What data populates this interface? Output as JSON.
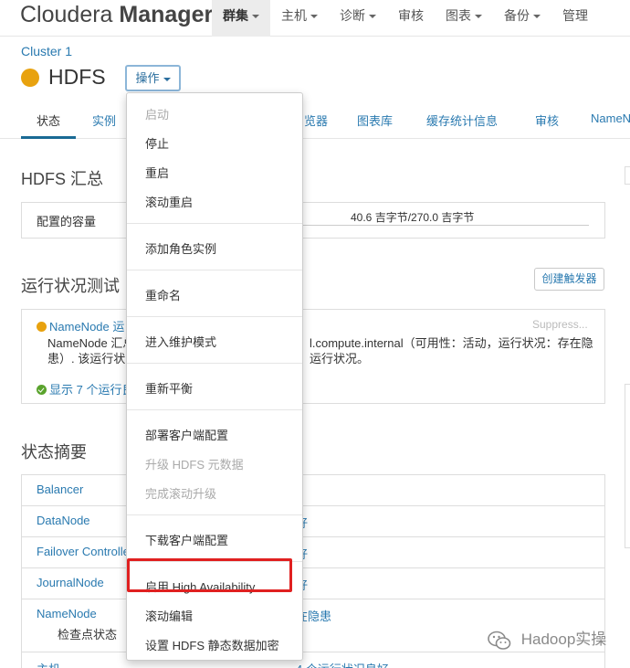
{
  "brand": {
    "name_thin": "Cloudera",
    "name_bold": "Manager"
  },
  "nav": {
    "items": [
      {
        "label": "群集",
        "active": true,
        "dropdown": true
      },
      {
        "label": "主机",
        "active": false,
        "dropdown": true
      },
      {
        "label": "诊断",
        "active": false,
        "dropdown": true
      },
      {
        "label": "审核",
        "active": false,
        "dropdown": false
      },
      {
        "label": "图表",
        "active": false,
        "dropdown": true
      },
      {
        "label": "备份",
        "active": false,
        "dropdown": true
      },
      {
        "label": "管理",
        "active": false,
        "dropdown": false
      }
    ]
  },
  "header": {
    "cluster": "Cluster 1",
    "service_name": "HDFS",
    "actions_label": "操作",
    "status_color": "#e8a20f"
  },
  "tabs": [
    {
      "label": "状态",
      "active": true
    },
    {
      "label": "实例",
      "active": false
    },
    {
      "label": "览器",
      "active": false
    },
    {
      "label": "图表库",
      "active": false
    },
    {
      "label": "缓存统计信息",
      "active": false
    },
    {
      "label": "审核",
      "active": false
    },
    {
      "label": "NameN",
      "active": false
    }
  ],
  "hdfs_summary": {
    "title": "HDFS 汇总",
    "capacity_label": "配置的容量",
    "capacity_value": "40.6 吉字节/270.0 吉字节"
  },
  "health": {
    "title": "运行状况测试",
    "create_trigger": "创建触发器",
    "item_name": "NameNode 运",
    "suppress": "Suppress...",
    "line2_left": "NameNode 汇总",
    "line2_right": "l.compute.internal（可用性：活动，运行状况：存在隐",
    "line3_left": "患）. 该运行状",
    "line3_right": "运行状况。",
    "show_more": "显示 7 个运行良"
  },
  "status_summary": {
    "title": "状态摘要",
    "rows": [
      {
        "name": "Balancer",
        "value": ""
      },
      {
        "name": "DataNode",
        "value": "好"
      },
      {
        "name": "Failover Controlle",
        "value": "好"
      },
      {
        "name": "JournalNode",
        "value": "好"
      },
      {
        "name": "NameNode",
        "value": "在隐患"
      },
      {
        "name": "主机",
        "value": "4 个运行状况良好"
      }
    ],
    "checkpoint_label": "检查点状态"
  },
  "menu": {
    "items": [
      {
        "label": "启动",
        "disabled": true
      },
      {
        "label": "停止",
        "disabled": false
      },
      {
        "label": "重启",
        "disabled": false
      },
      {
        "label": "滚动重启",
        "disabled": false
      },
      {
        "label": "添加角色实例",
        "disabled": false
      },
      {
        "label": "重命名",
        "disabled": false
      },
      {
        "label": "进入维护模式",
        "disabled": false
      },
      {
        "label": "重新平衡",
        "disabled": false
      },
      {
        "label": "部署客户端配置",
        "disabled": false
      },
      {
        "label": "升级 HDFS 元数据",
        "disabled": true
      },
      {
        "label": "完成滚动升级",
        "disabled": true
      },
      {
        "label": "下载客户端配置",
        "disabled": false
      },
      {
        "label": "启用 High Availability",
        "disabled": false
      },
      {
        "label": "滚动编辑",
        "disabled": false
      },
      {
        "label": "设置 HDFS 静态数据加密",
        "disabled": false
      }
    ],
    "highlight_color": "#e02020"
  },
  "watermark": {
    "text": "Hadoop实操"
  }
}
